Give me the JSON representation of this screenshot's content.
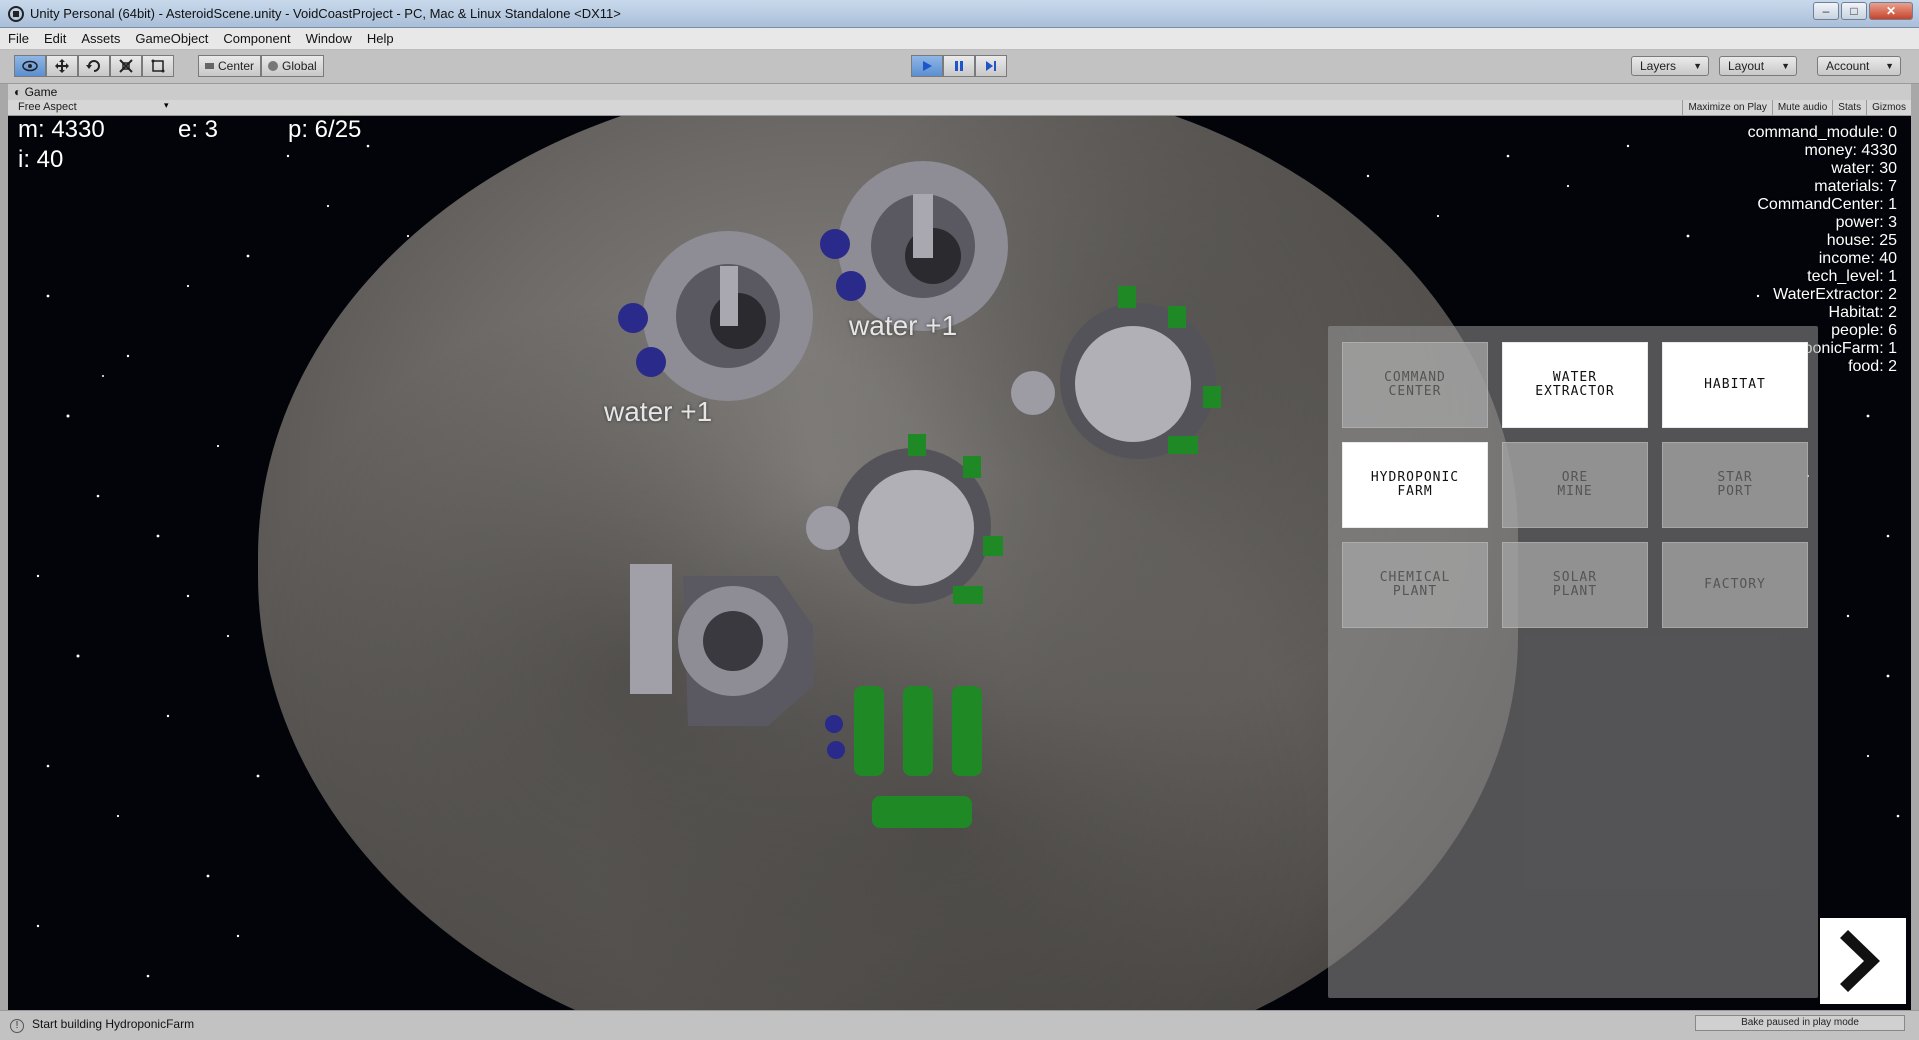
{
  "window": {
    "title": "Unity Personal (64bit) - AsteroidScene.unity - VoidCoastProject - PC, Mac & Linux Standalone <DX11>"
  },
  "menu": [
    "File",
    "Edit",
    "Assets",
    "GameObject",
    "Component",
    "Window",
    "Help"
  ],
  "toolbar": {
    "pivot": "Center",
    "space": "Global",
    "layers": "Layers",
    "layout": "Layout",
    "account": "Account"
  },
  "game": {
    "tab": "Game",
    "aspect": "Free Aspect",
    "buttons": [
      "Maximize on Play",
      "Mute audio",
      "Stats",
      "Gizmos"
    ]
  },
  "hud": {
    "money": "m: 4330",
    "energy": "e: 3",
    "population": "p: 6/25",
    "income": "i: 40"
  },
  "stats": [
    "command_module: 0",
    "money: 4330",
    "water: 30",
    "materials: 7",
    "CommandCenter: 1",
    "power: 3",
    "house: 25",
    "income: 40",
    "tech_level: 1",
    "WaterExtractor: 2",
    "Habitat: 2",
    "people: 6",
    "oponicFarm: 1",
    "food: 2"
  ],
  "floating_texts": [
    "water +1",
    "water +1"
  ],
  "build_buttons": [
    {
      "label": "COMMAND\nCENTER",
      "enabled": false
    },
    {
      "label": "WATER\nEXTRACTOR",
      "enabled": true
    },
    {
      "label": "HABITAT",
      "enabled": true
    },
    {
      "label": "HYDROPONIC\nFARM",
      "enabled": true
    },
    {
      "label": "ORE\nMINE",
      "enabled": false
    },
    {
      "label": "STAR\nPORT",
      "enabled": false
    },
    {
      "label": "CHEMICAL\nPLANT",
      "enabled": false
    },
    {
      "label": "SOLAR\nPLANT",
      "enabled": false
    },
    {
      "label": "FACTORY",
      "enabled": false
    }
  ],
  "status": {
    "message": "Start building HydroponicFarm",
    "bake": "Bake paused in play mode"
  },
  "colors": {
    "structure": "#8e8c94",
    "green": "#1f8a25",
    "blue": "#2a2a8a"
  }
}
